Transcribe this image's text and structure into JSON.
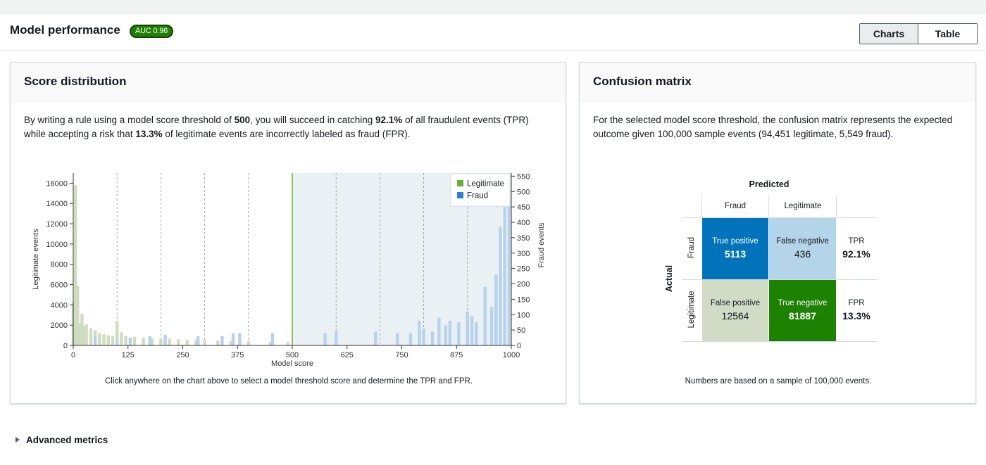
{
  "header": {
    "title": "Model performance",
    "auc_badge": "AUC 0.96",
    "view_toggle": {
      "charts_label": "Charts",
      "table_label": "Table",
      "selected": "Charts"
    }
  },
  "score_panel": {
    "title": "Score distribution",
    "desc_p1": "By writing a rule using a model score threshold of ",
    "threshold": "500",
    "desc_p2": ", you will succeed in catching ",
    "tpr": "92.1%",
    "desc_p3": " of all fraudulent events (TPR)",
    "desc_p4": "while accepting a risk that ",
    "fpr": "13.3%",
    "desc_p5": " of legitimate events are incorrectly labeled as fraud (FPR).",
    "hint": "Click anywhere on the chart above to select a model threshold score and determine the TPR and FPR."
  },
  "chart_data": {
    "type": "bar",
    "xlabel": "Model score",
    "ylabel": "Legitimate events",
    "y2label": "Fraud events",
    "xlim": [
      0,
      1000
    ],
    "ylim": [
      0,
      17000
    ],
    "y2lim": [
      0,
      560
    ],
    "x_ticks": [
      0,
      125,
      250,
      375,
      500,
      625,
      750,
      875,
      1000
    ],
    "y_ticks": [
      0,
      2000,
      4000,
      6000,
      8000,
      10000,
      12000,
      14000,
      16000
    ],
    "y2_ticks": [
      0,
      50,
      100,
      150,
      200,
      250,
      300,
      350,
      400,
      450,
      500,
      550
    ],
    "threshold": 500,
    "legend_position": "top-right",
    "grid": "vertical dashed every 100",
    "colors": {
      "legitimate": "#6aaf35",
      "legitimate_fill": "#cfdcc0",
      "fraud": "#2e7fd0",
      "fraud_fill": "#b7d2ea",
      "selected_region": "#eaf1f5"
    },
    "series": [
      {
        "name": "Legitimate",
        "x": [
          0,
          5,
          10,
          15,
          20,
          25,
          30,
          40,
          50,
          60,
          70,
          80,
          90,
          100,
          110,
          120,
          140,
          160,
          180,
          200,
          220,
          240,
          260,
          280,
          300,
          330,
          360,
          400,
          450,
          490
        ],
        "values": [
          4200,
          15800,
          5900,
          2200,
          3100,
          1900,
          2100,
          1700,
          1500,
          1200,
          1100,
          1000,
          950,
          2400,
          1300,
          900,
          850,
          750,
          700,
          650,
          620,
          600,
          550,
          520,
          500,
          470,
          440,
          400,
          360,
          330
        ]
      },
      {
        "name": "Fraud",
        "x": [
          50,
          100,
          130,
          175,
          210,
          285,
          340,
          365,
          380,
          455,
          575,
          600,
          690,
          740,
          770,
          790,
          800,
          820,
          835,
          850,
          860,
          880,
          900,
          910,
          920,
          940,
          955,
          965,
          975,
          985,
          995
        ],
        "values": [
          30,
          20,
          25,
          30,
          35,
          30,
          30,
          40,
          40,
          40,
          40,
          45,
          45,
          40,
          40,
          80,
          55,
          45,
          90,
          65,
          80,
          75,
          110,
          95,
          75,
          190,
          125,
          230,
          385,
          450,
          470
        ]
      }
    ]
  },
  "confusion_panel": {
    "title": "Confusion matrix",
    "desc_line1": "For the selected model score threshold, the confusion matrix represents the expected",
    "desc_line2": "outcome given 100,000 sample events (94,451 legitimate, 5,549 fraud).",
    "predicted_label": "Predicted",
    "actual_label": "Actual",
    "col_fraud": "Fraud",
    "col_legit": "Legitimate",
    "row_fraud": "Fraud",
    "row_legit": "Legitimate",
    "tp_label": "True positive",
    "tp_value": "5113",
    "fn_label": "False negative",
    "fn_value": "436",
    "fp_label": "False positive",
    "fp_value": "12564",
    "tn_label": "True negative",
    "tn_value": "81887",
    "tpr_label": "TPR",
    "tpr_value": "92.1%",
    "fpr_label": "FPR",
    "fpr_value": "13.3%",
    "colors": {
      "tp": "#0073bb",
      "fn": "#b4d4ea",
      "fp": "#d1dbc6",
      "tn": "#1d8102"
    },
    "note": "Numbers are based on a sample of 100,000 events."
  },
  "advanced": {
    "label": "Advanced metrics"
  }
}
